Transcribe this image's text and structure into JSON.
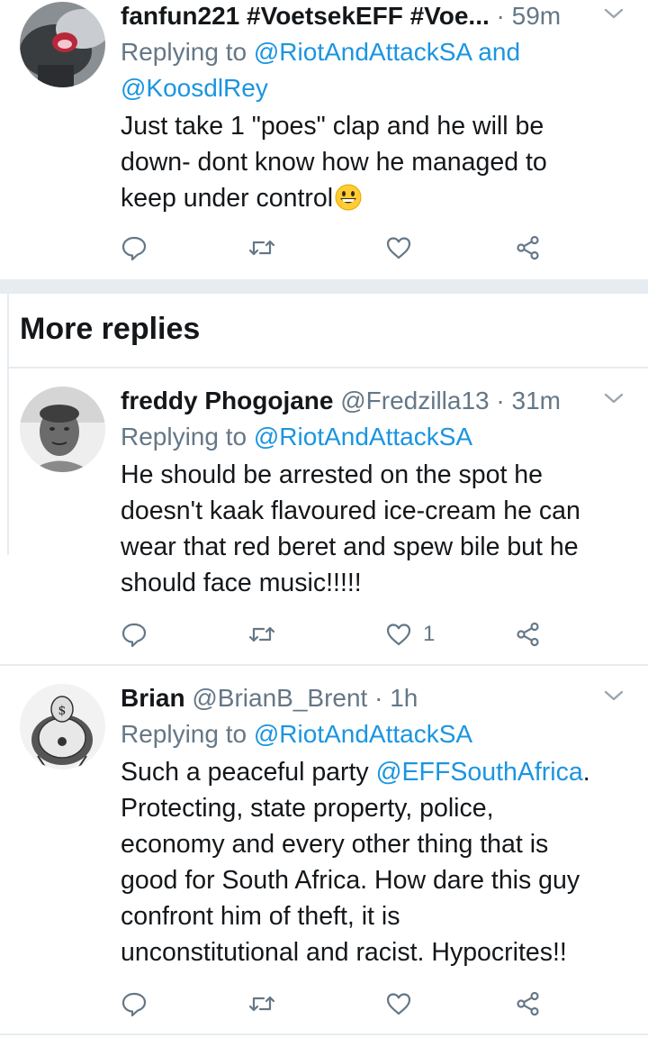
{
  "colors": {
    "link": "#1b95e0",
    "muted": "#657786",
    "text": "#14171a",
    "separator": "#e6ecf0"
  },
  "tweets": [
    {
      "name": "fanfun221 #VoetsekEFF #Voe...",
      "handle": "",
      "time": " · 59m",
      "reply_prefix": "Replying to ",
      "reply_to": "@RiotAndAttackSA and",
      "reply_to_2": "@KoosdlRey",
      "text": "Just take 1 \"poes\" clap and he will be\ndown- dont know how he managed to\nkeep under control",
      "emoji": "grinning-face-emoji",
      "like_count": ""
    },
    {
      "name": "freddy Phogojane",
      "handle": " @Fredzilla13",
      "time": " · 31m",
      "reply_prefix": "Replying to ",
      "reply_to": "@RiotAndAttackSA",
      "text": "He should be arrested on the spot he\ndoesn't kaak flavoured ice-cream he can\nwear that red beret and spew bile but he\nshould face music!!!!!",
      "like_count": "1"
    },
    {
      "name": "Brian",
      "handle": " @BrianB_Brent",
      "time": " · 1h",
      "reply_prefix": "Replying to ",
      "reply_to": "@RiotAndAttackSA",
      "text_before": "Such a peaceful party ",
      "text_mention": "@EFFSouthAfrica",
      "text_after": ".\nProtecting, state property, police,\neconomy and every other thing that is\ngood for South Africa.  How dare this guy\nconfront him of theft, it is\nunconstitutional and racist.  Hypocrites!!",
      "like_count": ""
    }
  ],
  "section": {
    "more_replies": "More replies"
  },
  "icons": [
    "reply-icon",
    "retweet-icon",
    "like-icon",
    "share-icon",
    "chevron-down-icon"
  ]
}
